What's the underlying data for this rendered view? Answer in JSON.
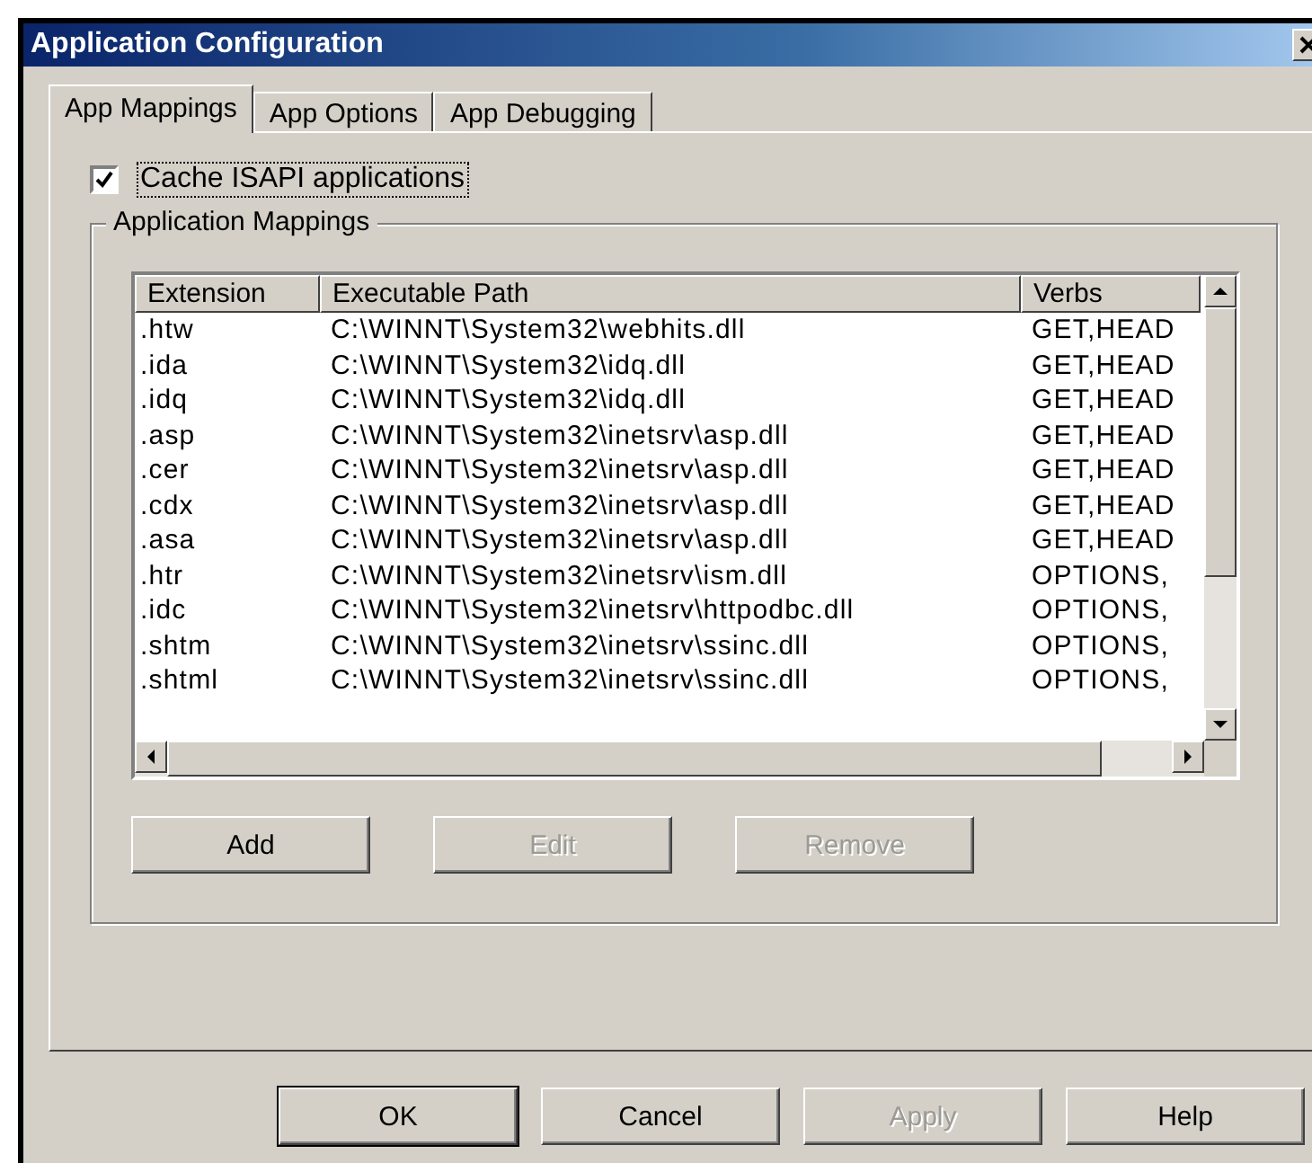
{
  "window": {
    "title": "Application Configuration"
  },
  "tabs": [
    {
      "label": "App Mappings",
      "selected": true
    },
    {
      "label": "App Options",
      "selected": false
    },
    {
      "label": "App Debugging",
      "selected": false
    }
  ],
  "cache_checkbox": {
    "label": "Cache ISAPI applications",
    "checked": true
  },
  "group": {
    "title": "Application Mappings"
  },
  "table": {
    "columns": [
      "Extension",
      "Executable Path",
      "Verbs"
    ],
    "rows": [
      [
        ".htw",
        "C:\\WINNT\\System32\\webhits.dll",
        "GET,HEAD"
      ],
      [
        ".ida",
        "C:\\WINNT\\System32\\idq.dll",
        "GET,HEAD"
      ],
      [
        ".idq",
        "C:\\WINNT\\System32\\idq.dll",
        "GET,HEAD"
      ],
      [
        ".asp",
        "C:\\WINNT\\System32\\inetsrv\\asp.dll",
        "GET,HEAD"
      ],
      [
        ".cer",
        "C:\\WINNT\\System32\\inetsrv\\asp.dll",
        "GET,HEAD"
      ],
      [
        ".cdx",
        "C:\\WINNT\\System32\\inetsrv\\asp.dll",
        "GET,HEAD"
      ],
      [
        ".asa",
        "C:\\WINNT\\System32\\inetsrv\\asp.dll",
        "GET,HEAD"
      ],
      [
        ".htr",
        "C:\\WINNT\\System32\\inetsrv\\ism.dll",
        "OPTIONS,"
      ],
      [
        ".idc",
        "C:\\WINNT\\System32\\inetsrv\\httpodbc.dll",
        "OPTIONS,"
      ],
      [
        ".shtm",
        "C:\\WINNT\\System32\\inetsrv\\ssinc.dll",
        "OPTIONS,"
      ],
      [
        ".shtml",
        "C:\\WINNT\\System32\\inetsrv\\ssinc.dll",
        "OPTIONS,"
      ]
    ]
  },
  "mapping_buttons": [
    {
      "label": "Add",
      "disabled": false
    },
    {
      "label": "Edit",
      "disabled": true
    },
    {
      "label": "Remove",
      "disabled": true
    }
  ],
  "dialog_buttons": [
    {
      "label": "OK",
      "disabled": false,
      "default": true
    },
    {
      "label": "Cancel",
      "disabled": false,
      "default": false
    },
    {
      "label": "Apply",
      "disabled": true,
      "default": false
    },
    {
      "label": "Help",
      "disabled": false,
      "default": false
    }
  ]
}
